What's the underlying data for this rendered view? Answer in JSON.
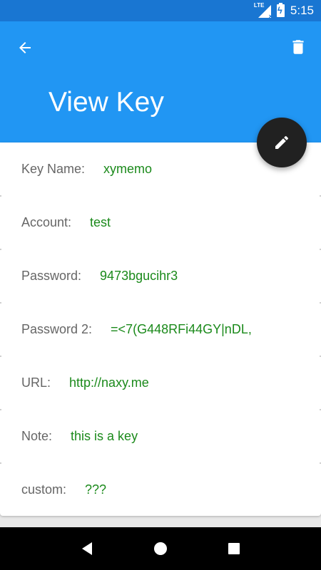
{
  "status_bar": {
    "network_label": "LTE",
    "time": "5:15"
  },
  "app_bar": {
    "title": "View Key",
    "back_icon": "arrow-left-icon",
    "delete_icon": "trash-icon",
    "color": "#2196f3"
  },
  "fab": {
    "icon": "pencil-icon",
    "color": "#212121"
  },
  "fields": [
    {
      "label": "Key Name:",
      "value": "xymemo"
    },
    {
      "label": "Account:",
      "value": "test"
    },
    {
      "label": "Password:",
      "value": "9473bgucihr3"
    },
    {
      "label": "Password 2:",
      "value": "=<7(G448RFi44GY|nDL,"
    },
    {
      "label": "URL:",
      "value": "http://naxy.me"
    },
    {
      "label": "Note:",
      "value": "this is a key"
    },
    {
      "label": "custom:",
      "value": "???"
    }
  ],
  "colors": {
    "value_text": "#1b8a1b",
    "label_text": "#666666",
    "status_bar": "#1976d2"
  },
  "nav_bar": {
    "back_icon": "nav-back-icon",
    "home_icon": "nav-home-icon",
    "recents_icon": "nav-recents-icon"
  }
}
